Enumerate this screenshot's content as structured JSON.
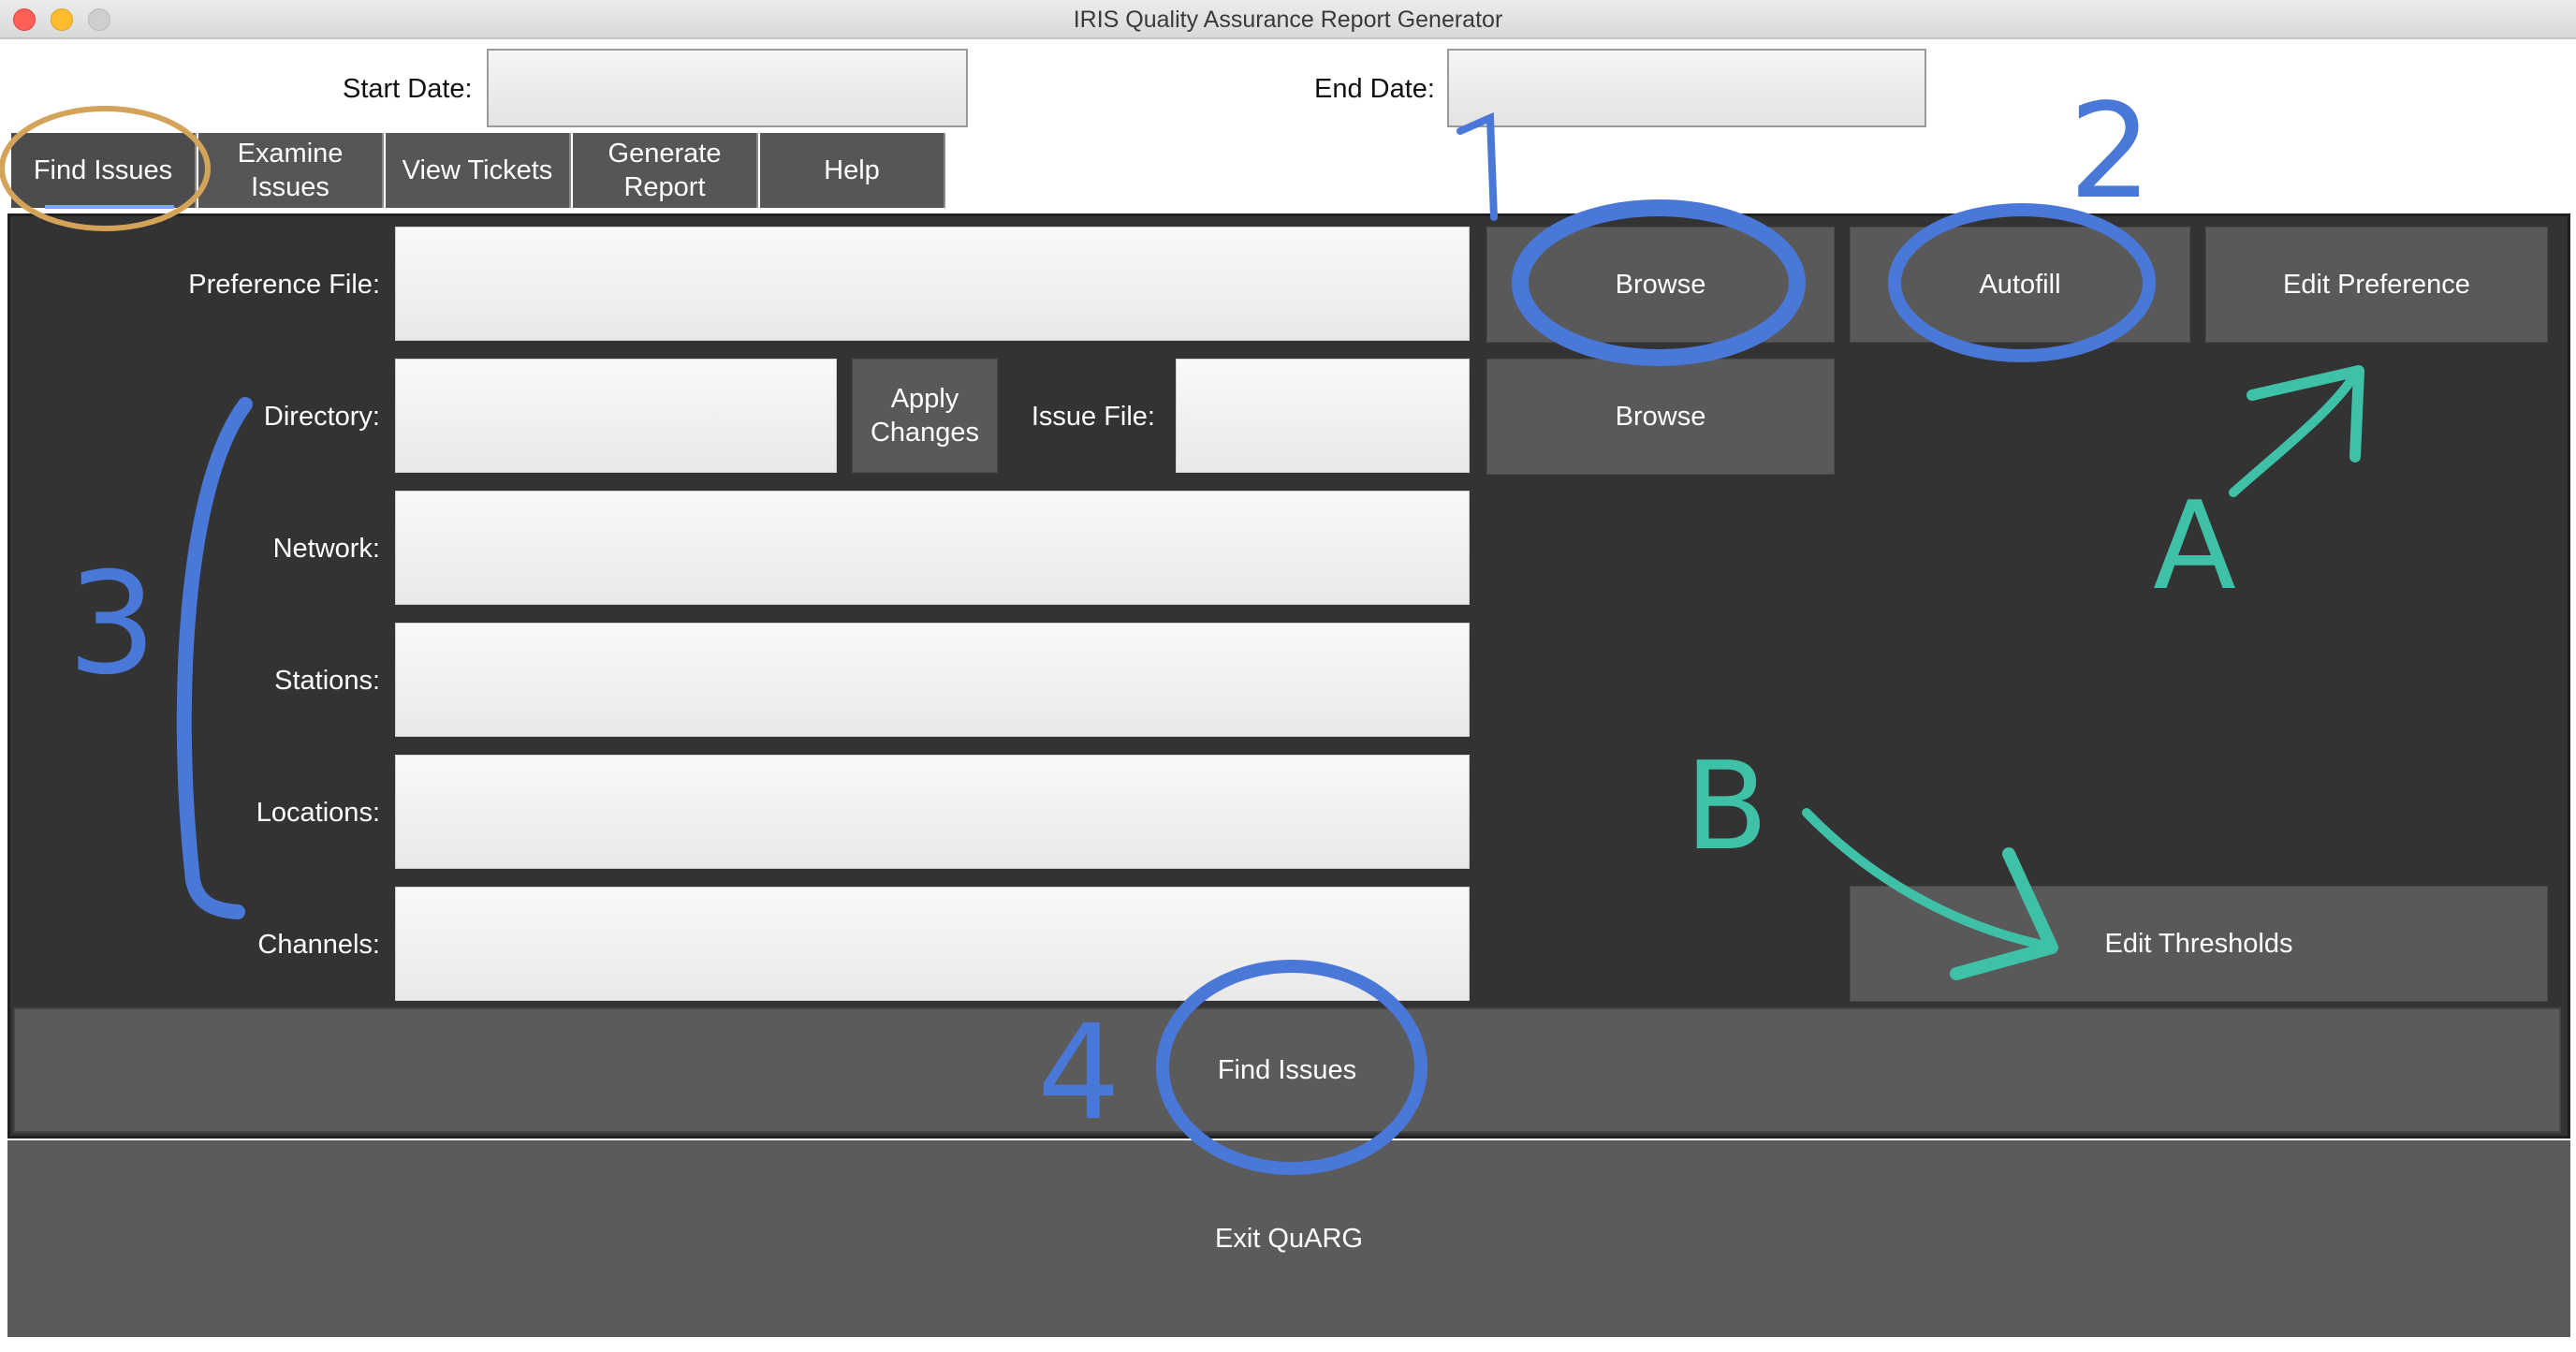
{
  "window": {
    "title": "IRIS Quality Assurance Report Generator"
  },
  "dates": {
    "start_label": "Start Date:",
    "start_value": "",
    "end_label": "End Date:",
    "end_value": ""
  },
  "tabs": [
    {
      "label": "Find Issues",
      "active": true
    },
    {
      "label": "Examine\nIssues",
      "active": false
    },
    {
      "label": "View Tickets",
      "active": false
    },
    {
      "label": "Generate\nReport",
      "active": false
    },
    {
      "label": "Help",
      "active": false
    }
  ],
  "form": {
    "preference_label": "Preference File:",
    "preference_value": "",
    "directory_label": "Directory:",
    "directory_value": "",
    "apply_changes_label": "Apply\nChanges",
    "issue_file_label": "Issue File:",
    "issue_file_value": "",
    "network_label": "Network:",
    "network_value": "",
    "stations_label": "Stations:",
    "stations_value": "",
    "locations_label": "Locations:",
    "locations_value": "",
    "channels_label": "Channels:",
    "channels_value": ""
  },
  "buttons": {
    "browse_preference": "Browse",
    "autofill": "Autofill",
    "edit_preference": "Edit Preference",
    "browse_issue": "Browse",
    "edit_thresholds": "Edit Thresholds",
    "find_issues": "Find Issues",
    "exit": "Exit QuARG"
  },
  "annotations": {
    "mark_1": "1",
    "mark_2": "2",
    "mark_3": "3",
    "mark_4": "4",
    "mark_a": "A",
    "mark_b": "B",
    "colors": {
      "blue": "#4a78d8",
      "teal": "#3fc1a7",
      "gold": "#d4a35a"
    }
  },
  "colors": {
    "panel": "#333333",
    "button": "#595959",
    "tab": "#565656"
  }
}
